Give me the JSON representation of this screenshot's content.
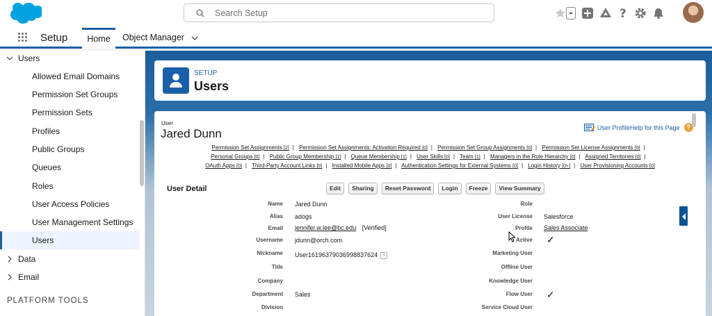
{
  "search": {
    "placeholder": "Search Setup"
  },
  "nav": {
    "app": "Setup",
    "tabs": [
      {
        "label": "Home"
      },
      {
        "label": "Object Manager"
      }
    ]
  },
  "sidebar": {
    "section": "Users",
    "items": [
      {
        "label": "Allowed Email Domains"
      },
      {
        "label": "Permission Set Groups"
      },
      {
        "label": "Permission Sets"
      },
      {
        "label": "Profiles"
      },
      {
        "label": "Public Groups"
      },
      {
        "label": "Queues"
      },
      {
        "label": "Roles"
      },
      {
        "label": "User Access Policies"
      },
      {
        "label": "User Management Settings"
      },
      {
        "label": "Users"
      }
    ],
    "groups": [
      {
        "label": "Data"
      },
      {
        "label": "Email"
      }
    ],
    "footer": "PLATFORM TOOLS"
  },
  "header": {
    "subtitle": "SETUP",
    "title": "Users"
  },
  "user": {
    "type_label": "User",
    "name": "Jared Dunn",
    "help_link": "User ProfileHelp for this Page",
    "related_lists": [
      [
        {
          "label": "Permission Set Assignments",
          "count": "[2]"
        },
        {
          "label": "Permission Set Assignments: Activation Required",
          "count": "[0]"
        },
        {
          "label": "Permission Set Group Assignments",
          "count": "[0]"
        },
        {
          "label": "Permission Set License Assignments",
          "count": "[0]"
        }
      ],
      [
        {
          "label": "Personal Groups",
          "count": "[0]"
        },
        {
          "label": "Public Group Membership",
          "count": "[1]"
        },
        {
          "label": "Queue Membership",
          "count": "[1]"
        },
        {
          "label": "User Skills",
          "count": "[0]"
        },
        {
          "label": "Team",
          "count": "[1]"
        },
        {
          "label": "Managers in the Role Hierarchy",
          "count": "[0]"
        },
        {
          "label": "Assigned Territories",
          "count": "[0]"
        }
      ],
      [
        {
          "label": "OAuth Apps",
          "count": "[0]"
        },
        {
          "label": "Third-Party Account Links",
          "count": "[0]"
        },
        {
          "label": "Installed Mobile Apps",
          "count": "[0]"
        },
        {
          "label": "Authentication Settings for External Systems",
          "count": "[0]"
        },
        {
          "label": "Login History",
          "count": "[0+]"
        },
        {
          "label": "User Provisioning Accounts",
          "count": "[0]"
        }
      ]
    ],
    "section_title": "User Detail",
    "buttons": [
      "Edit",
      "Sharing",
      "Reset Password",
      "Login",
      "Freeze",
      "View Summary"
    ],
    "left_fields": [
      {
        "label": "Name",
        "value": "Jared Dunn"
      },
      {
        "label": "Alias",
        "value": "adogs"
      },
      {
        "label": "Email",
        "value": "jennifer.w.lee@bc.edu",
        "extra": "[Verified]"
      },
      {
        "label": "Username",
        "value": "jdunn@orch.com"
      },
      {
        "label": "Nickname",
        "value": "User16196379036998837624"
      },
      {
        "label": "Title",
        "value": ""
      },
      {
        "label": "Company",
        "value": ""
      },
      {
        "label": "Department",
        "value": "Sales"
      },
      {
        "label": "Division",
        "value": ""
      }
    ],
    "right_fields": [
      {
        "label": "Role",
        "value": ""
      },
      {
        "label": "User License",
        "value": "Salesforce"
      },
      {
        "label": "Profile",
        "value": "Sales Associate"
      },
      {
        "label": "Active",
        "value": "✓"
      },
      {
        "label": "Marketing User",
        "value": ""
      },
      {
        "label": "Offline User",
        "value": ""
      },
      {
        "label": "Knowledge User",
        "value": ""
      },
      {
        "label": "Flow User",
        "value": "✓"
      },
      {
        "label": "Service Cloud User",
        "value": ""
      }
    ]
  }
}
